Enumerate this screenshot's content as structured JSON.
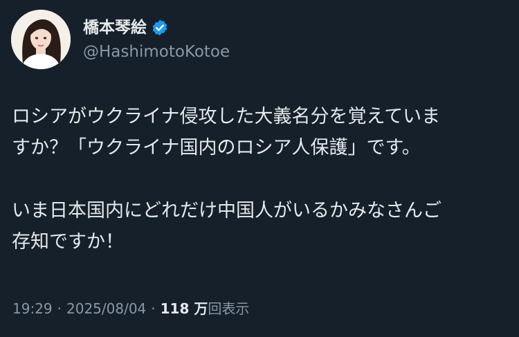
{
  "author": {
    "display_name": "橋本琴絵",
    "handle": "@HashimotoKotoe",
    "verified_icon": "verified-badge-icon",
    "verified_color": "#1d9bf0"
  },
  "post": {
    "paragraphs": [
      "ロシアがウクライナ侵攻した大義名分を覚えていま\nすか？「ウクライナ国内のロシア人保護」です。",
      "いま日本国内にどれだけ中国人がいるかみなさんご\n存知ですか！"
    ]
  },
  "meta": {
    "time": "19:29",
    "separator": "·",
    "date": "2025/08/04",
    "views_count": "118 万",
    "views_label": "回表示"
  },
  "colors": {
    "background": "#15202b",
    "text_primary": "#e7e9ea",
    "text_secondary": "#8b98a5"
  }
}
